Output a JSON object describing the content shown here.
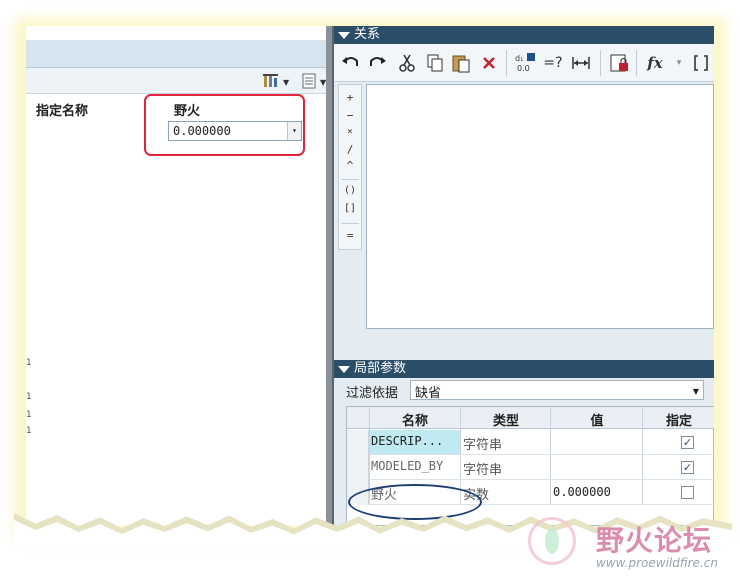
{
  "left_panel": {
    "col_headers": [
      "指定名称",
      "野火"
    ],
    "cell_value": "0.000000",
    "cell_dropdown_glyph": "▾",
    "left_marks": [
      "1",
      "1",
      "1",
      "1"
    ]
  },
  "relations": {
    "header": "关系",
    "toolbar": [
      "undo-icon",
      "redo-icon",
      "cut-icon",
      "copy-icon",
      "paste-icon",
      "delete-icon",
      "value-icon",
      "verify-icon",
      "measure-icon",
      "lock-icon",
      "function-icon",
      "brackets-icon"
    ],
    "toolbar_text": {
      "verify": "=?",
      "function": "fx"
    },
    "operators": [
      "+",
      "−",
      "×",
      "/",
      "^",
      "()",
      "[]",
      "="
    ]
  },
  "local_params": {
    "header": "局部参数",
    "filter_label": "过滤依据",
    "filter_value": "缺省",
    "columns": [
      "名称",
      "类型",
      "值",
      "指定"
    ],
    "rows": [
      {
        "name": "DESCRIP...",
        "type": "字符串",
        "value": "",
        "checked": true
      },
      {
        "name": "MODELED_BY",
        "type": "字符串",
        "value": "",
        "checked": true
      },
      {
        "name": "野火",
        "type": "实数",
        "value": "0.000000",
        "checked": false
      }
    ]
  },
  "watermark": {
    "title": "野火论坛",
    "url": "www.proewildfire.cn"
  },
  "colors": {
    "header_bg": "#2b4e68",
    "highlight_red": "#e0243c",
    "oval_blue": "#1d3f78",
    "selected_cell": "#bfeaf2"
  }
}
